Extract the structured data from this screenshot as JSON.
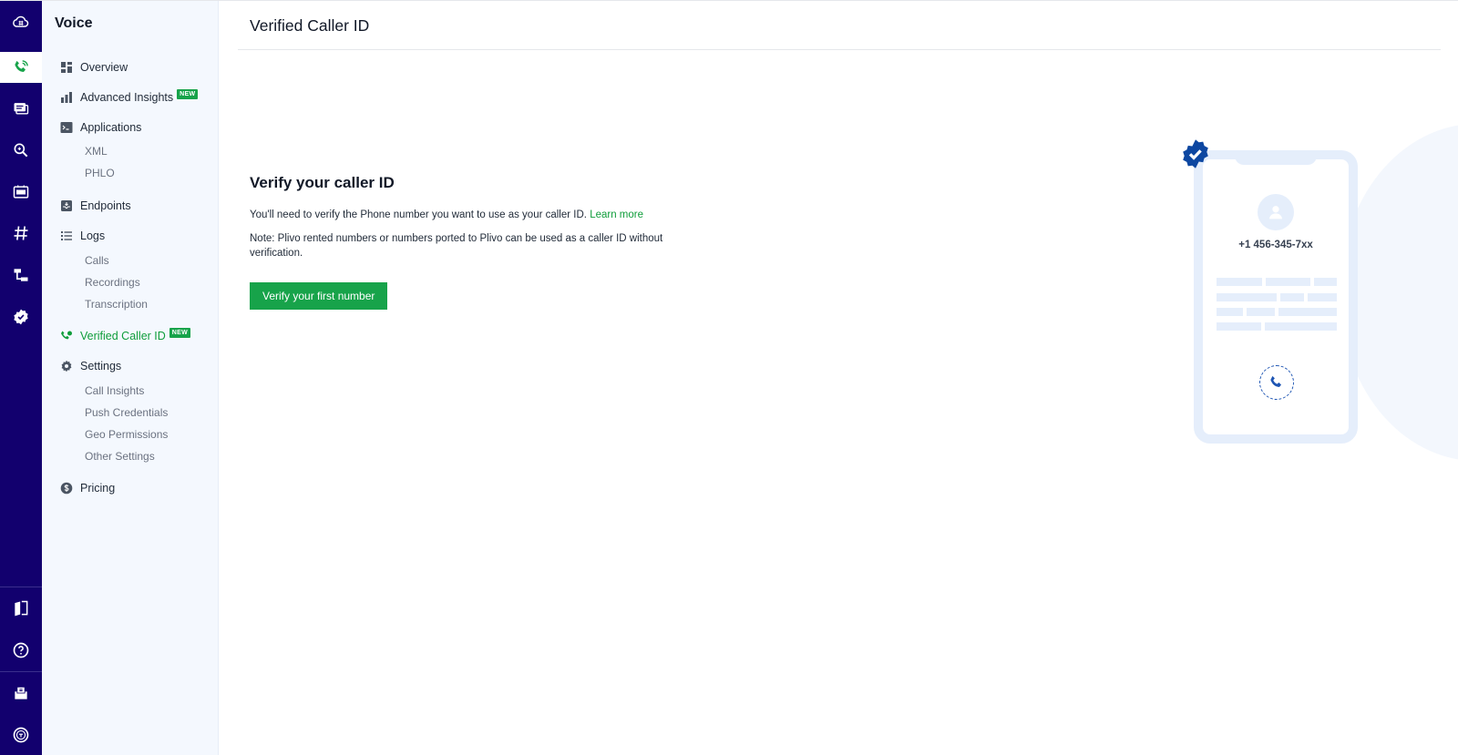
{
  "rail": {
    "items": [
      {
        "name": "cloud-icon"
      },
      {
        "name": "voice-icon",
        "active": true
      },
      {
        "name": "messaging-icon"
      },
      {
        "name": "lookup-icon"
      },
      {
        "name": "sip-icon"
      },
      {
        "name": "numbers-icon"
      },
      {
        "name": "phlo-icon"
      },
      {
        "name": "verify-icon"
      },
      {
        "name": "docs-icon"
      },
      {
        "name": "help-icon"
      },
      {
        "name": "billing-icon"
      },
      {
        "name": "account-icon"
      }
    ]
  },
  "sidebar": {
    "title": "Voice",
    "items": [
      {
        "label": "Overview",
        "icon": "dashboard-icon"
      },
      {
        "label": "Advanced Insights",
        "icon": "bar-chart-icon",
        "badge": "NEW"
      },
      {
        "label": "Applications",
        "icon": "terminal-icon",
        "children": [
          "XML",
          "PHLO"
        ]
      },
      {
        "label": "Endpoints",
        "icon": "inbox-icon"
      },
      {
        "label": "Logs",
        "icon": "list-icon",
        "children": [
          "Calls",
          "Recordings",
          "Transcription"
        ]
      },
      {
        "label": "Verified Caller ID",
        "icon": "phone-check-icon",
        "badge": "NEW",
        "active": true
      },
      {
        "label": "Settings",
        "icon": "gear-icon",
        "children": [
          "Call Insights",
          "Push Credentials",
          "Geo Permissions",
          "Other Settings"
        ]
      },
      {
        "label": "Pricing",
        "icon": "dollar-icon"
      }
    ]
  },
  "main": {
    "page_title": "Verified Caller ID",
    "heading": "Verify your caller ID",
    "description": "You'll need to verify the Phone number you want to use as your caller ID.",
    "learn_more": "Learn more",
    "note": "Note: Plivo rented numbers or numbers ported to Plivo can be used as a caller ID without verification.",
    "cta_label": "Verify your first number"
  },
  "illustration": {
    "phone_number": "+1 456-345-7xx"
  },
  "colors": {
    "rail_bg": "#12006e",
    "accent_green": "#17a34a",
    "illustration_blue": "#1e55b3",
    "illustration_light": "#e5eefb"
  }
}
